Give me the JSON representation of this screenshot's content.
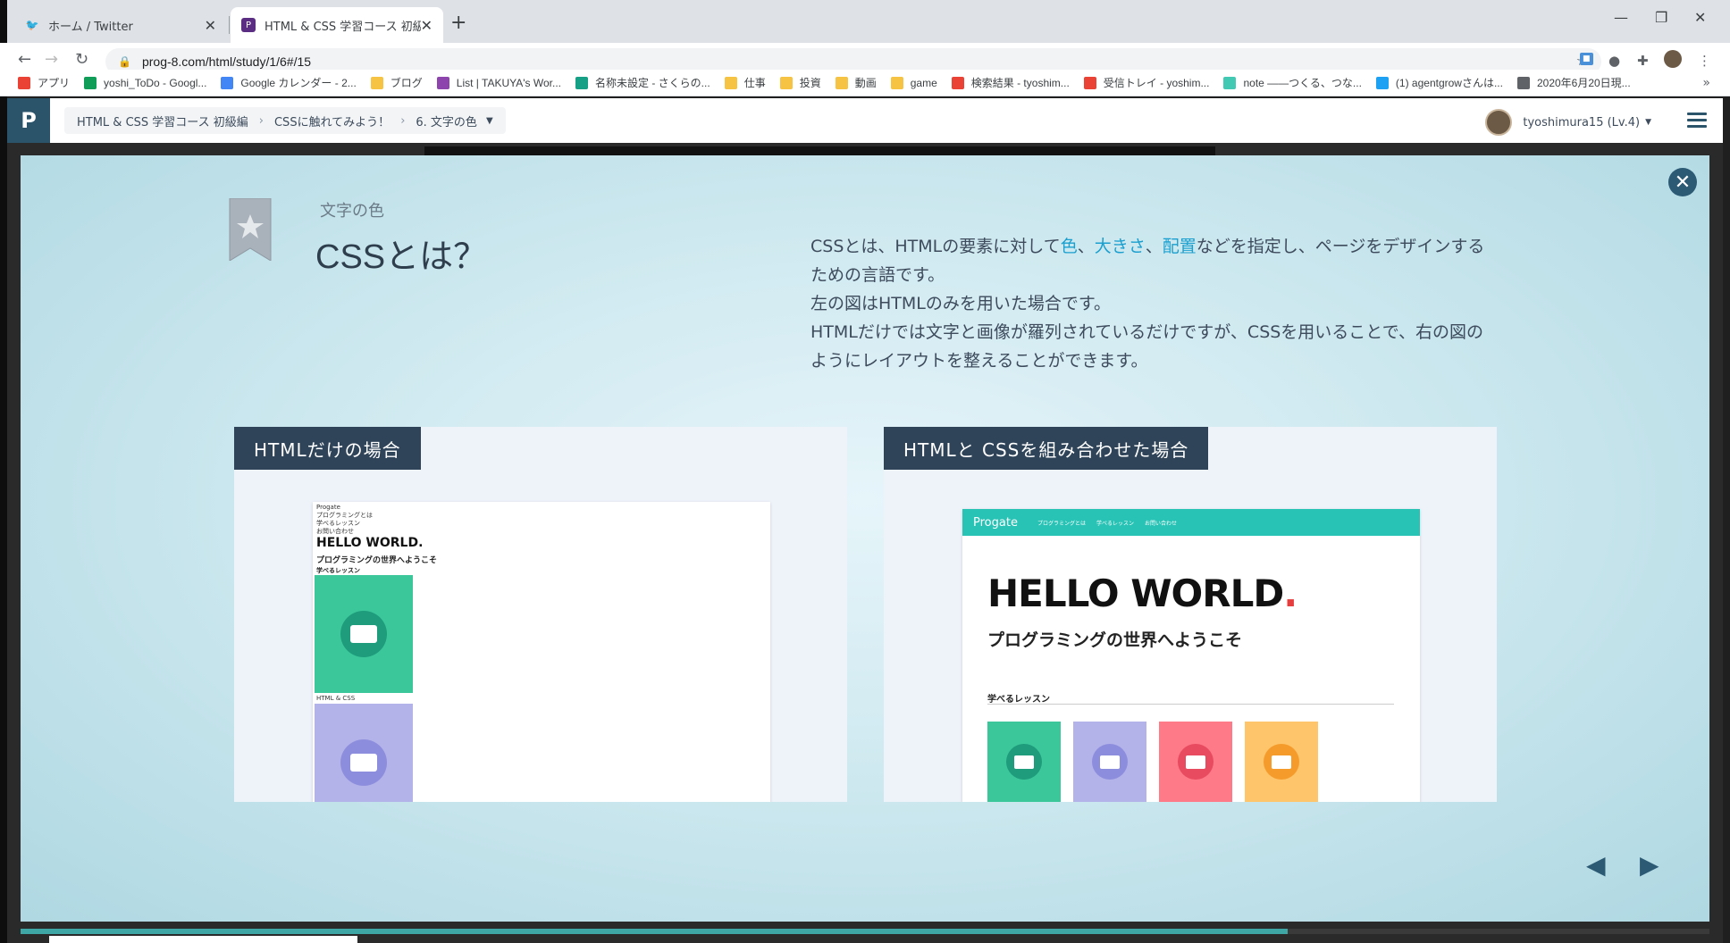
{
  "browser": {
    "tabs": [
      {
        "title": "ホーム / Twitter",
        "icon": "twitter-icon"
      },
      {
        "title": "HTML & CSS 学習コース 初級編 | ...",
        "icon": "progate-icon"
      }
    ],
    "url": "prog-8.com/html/study/1/6#/15"
  },
  "bookmarks": [
    {
      "label": "アプリ",
      "color": "#ea4335"
    },
    {
      "label": "yoshi_ToDo - Googl...",
      "color": "#0f9d58"
    },
    {
      "label": "Google カレンダー - 2...",
      "color": "#4285f4"
    },
    {
      "label": "ブログ",
      "color": "#f6c343"
    },
    {
      "label": "List | TAKUYA's Wor...",
      "color": "#8e44ad"
    },
    {
      "label": "名称未設定 - さくらの...",
      "color": "#16a085"
    },
    {
      "label": "仕事",
      "color": "#f6c343"
    },
    {
      "label": "投資",
      "color": "#f6c343"
    },
    {
      "label": "動画",
      "color": "#f6c343"
    },
    {
      "label": "game",
      "color": "#f6c343"
    },
    {
      "label": "検索結果 - tyoshim...",
      "color": "#ea4335"
    },
    {
      "label": "受信トレイ - yoshim...",
      "color": "#ea4335"
    },
    {
      "label": "note ――つくる、つな...",
      "color": "#41c9b4"
    },
    {
      "label": "(1) agentgrowさんは...",
      "color": "#1da1f2"
    },
    {
      "label": "2020年6月20日現...",
      "color": "#5f6368"
    }
  ],
  "appbar": {
    "logo": "P",
    "breadcrumbs": [
      "HTML & CSS 学習コース 初級編",
      "CSSに触れてみよう！",
      "6. 文字の色"
    ],
    "user": "tyoshimura15 (Lv.4)"
  },
  "slide": {
    "subtitle": "文字の色",
    "title": "CSSとは？",
    "desc": {
      "p1_a": "CSSとは、HTMLの要素に対して",
      "hl1": "色",
      "sep1": "、",
      "hl2": "大きさ",
      "sep2": "、",
      "hl3": "配置",
      "p1_b": "などを指定し、ページをデザインするための言語です。",
      "p2": "左の図はHTMLのみを用いた場合です。",
      "p3": "HTMLだけでは文字と画像が羅列されているだけですが、CSSを用いることで、右の図のようにレイアウトを整えることができます。"
    },
    "left_panel": {
      "label": "HTMLだけの場合",
      "preview_lines": [
        "Progate",
        "プログラミングとは",
        "学べるレッスン",
        "お問い合わせ"
      ],
      "hello": "HELLO WORLD.",
      "welcome": "プログラミングの世界へようこそ",
      "learn": "学べるレッスン",
      "caption": "HTML & CSS"
    },
    "right_panel": {
      "label": "HTMLと CSSを組み合わせた場合",
      "site_logo": "Progate",
      "nav": [
        "プログラミングとは",
        "学べるレッスン",
        "お問い合わせ"
      ],
      "hello": "HELLO WORLD",
      "hello_dot": ".",
      "welcome": "プログラミングの世界へようこそ",
      "learn": "学べるレッスン"
    }
  },
  "progress": 0.75
}
